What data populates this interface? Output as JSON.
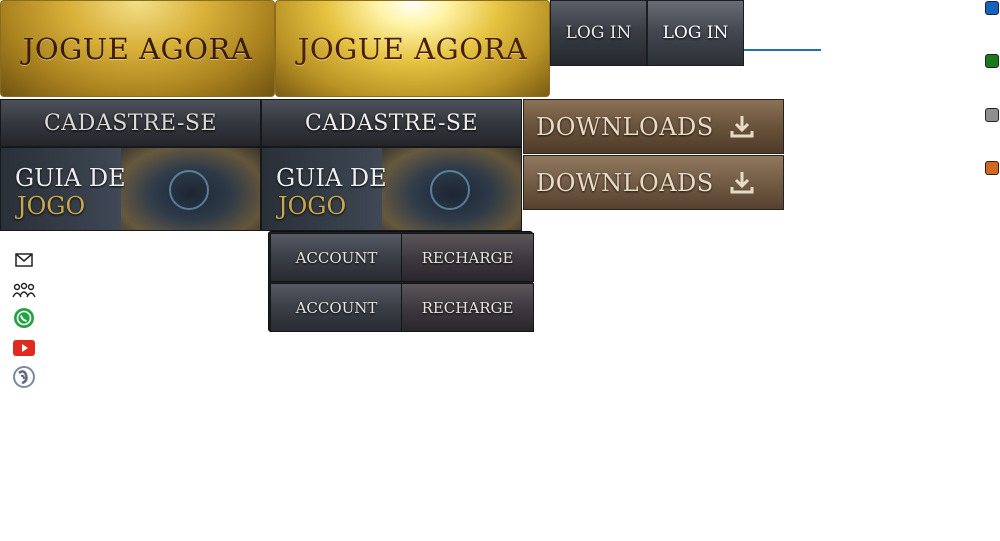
{
  "sprites": {
    "jogue_agora": {
      "normal_label": "JOGUE AGORA",
      "hover_label": "JOGUE AGORA"
    },
    "login": {
      "normal_label": "LOG IN",
      "hover_label": "LOG IN"
    },
    "cadastre": {
      "normal_label": "CADASTRE-SE",
      "hover_label": "CADASTRE-SE"
    },
    "guia": {
      "normal": {
        "line1": "GUIA DE",
        "line2": "JOGO"
      },
      "hover": {
        "line1": "GUIA DE",
        "line2": "JOGO"
      }
    },
    "downloads": {
      "normal_label": "DOWNLOADS",
      "hover_label": "DOWNLOADS",
      "icon": "download-icon"
    },
    "account_bar": {
      "row1": {
        "account": "ACCOUNT",
        "recharge": "RECHARGE"
      },
      "row2": {
        "account": "ACCOUNT",
        "recharge": "RECHARGE"
      }
    }
  },
  "social_icons": [
    "mail-icon",
    "community-icon",
    "whatsapp-icon",
    "youtube-icon",
    "teamspeak-icon"
  ],
  "swatches": [
    {
      "name": "blue",
      "color": "#1565c0"
    },
    {
      "name": "green",
      "color": "#1b7a1b"
    },
    {
      "name": "gray",
      "color": "#8f8f8f"
    },
    {
      "name": "orange",
      "color": "#d2691e"
    }
  ]
}
